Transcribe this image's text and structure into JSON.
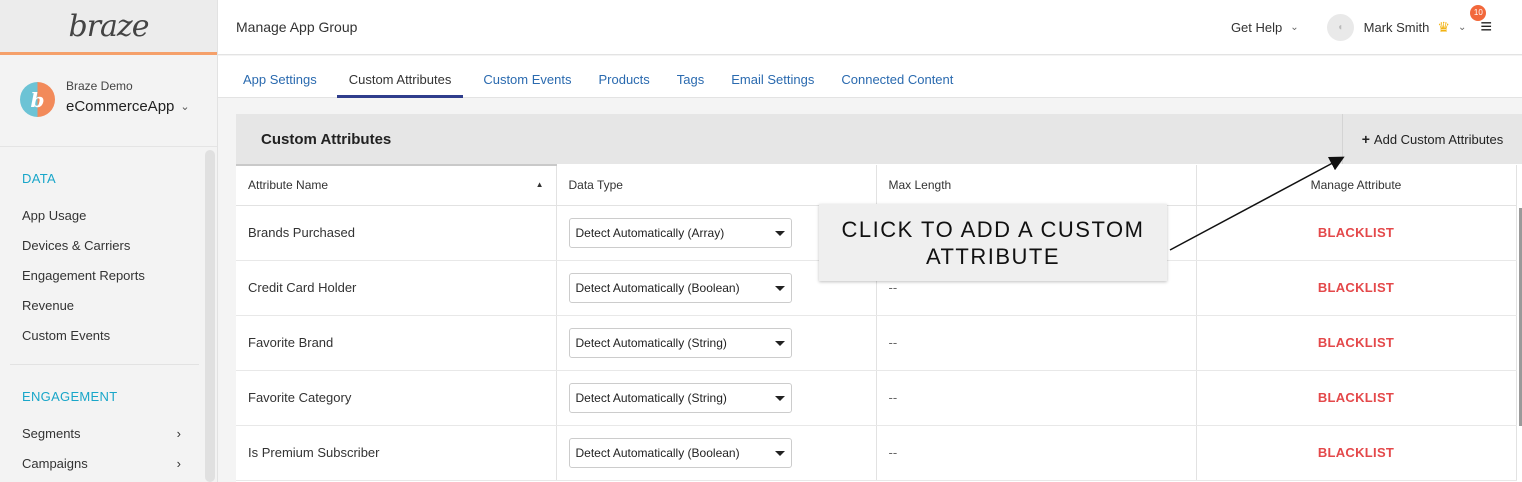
{
  "logo": "braze",
  "app_group": {
    "org": "Braze Demo",
    "app": "eCommerceApp",
    "avatar_letter": "b"
  },
  "sidebar": {
    "sections": [
      {
        "heading": "DATA",
        "items": [
          "App Usage",
          "Devices & Carriers",
          "Engagement Reports",
          "Revenue",
          "Custom Events"
        ]
      },
      {
        "heading": "ENGAGEMENT",
        "items": [
          "Segments",
          "Campaigns"
        ]
      }
    ]
  },
  "topbar": {
    "title": "Manage App Group",
    "get_help": "Get Help",
    "user_name": "Mark Smith",
    "notification_count": "10"
  },
  "tabs": [
    {
      "label": "App Settings",
      "active": false
    },
    {
      "label": "Custom Attributes",
      "active": true
    },
    {
      "label": "Custom Events",
      "active": false
    },
    {
      "label": "Products",
      "active": false
    },
    {
      "label": "Tags",
      "active": false
    },
    {
      "label": "Email Settings",
      "active": false
    },
    {
      "label": "Connected Content",
      "active": false
    }
  ],
  "panel": {
    "title": "Custom Attributes",
    "add_button": "Add Custom Attributes",
    "columns": [
      "Attribute Name",
      "Data Type",
      "Max Length",
      "Manage Attribute"
    ],
    "rows": [
      {
        "name": "Brands Purchased",
        "type": "Detect Automatically (Array)",
        "max": "--",
        "action": "BLACKLIST"
      },
      {
        "name": "Credit Card Holder",
        "type": "Detect Automatically (Boolean)",
        "max": "--",
        "action": "BLACKLIST"
      },
      {
        "name": "Favorite Brand",
        "type": "Detect Automatically (String)",
        "max": "--",
        "action": "BLACKLIST"
      },
      {
        "name": "Favorite Category",
        "type": "Detect Automatically (String)",
        "max": "--",
        "action": "BLACKLIST"
      },
      {
        "name": "Is Premium Subscriber",
        "type": "Detect Automatically (Boolean)",
        "max": "--",
        "action": "BLACKLIST"
      }
    ]
  },
  "callout": {
    "line1": "CLICK TO ADD A CUSTOM",
    "line2": "ATTRIBUTE"
  },
  "colors": {
    "accent_blue": "#19a6c9",
    "tab_active": "#2f3d8c",
    "blacklist": "#e4484a",
    "logo_underline": "#f5a06a"
  }
}
